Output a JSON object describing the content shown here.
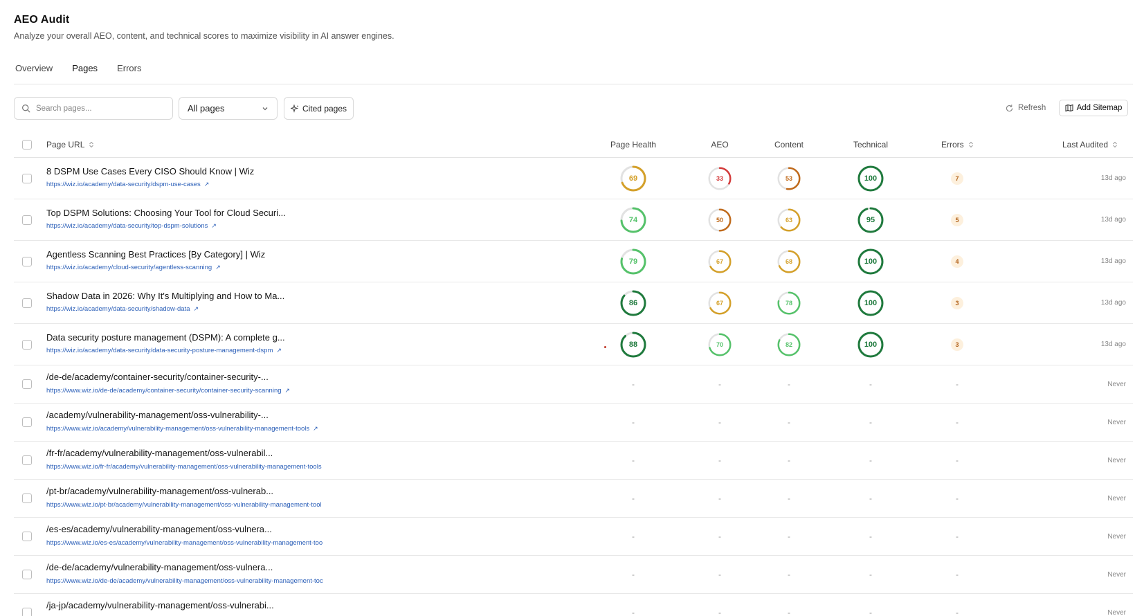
{
  "header": {
    "title": "AEO Audit",
    "subtitle": "Analyze your overall AEO, content, and technical scores to maximize visibility in AI answer engines."
  },
  "tabs": [
    "Overview",
    "Pages",
    "Errors"
  ],
  "active_tab": "Pages",
  "toolbar": {
    "search_placeholder": "Search pages...",
    "filter_value": "All pages",
    "cited_label": "Cited pages",
    "refresh_label": "Refresh",
    "sitemap_label": "Add Sitemap"
  },
  "columns": {
    "url": "Page URL",
    "health": "Page Health",
    "aeo": "AEO",
    "content": "Content",
    "technical": "Technical",
    "errors": "Errors",
    "audited": "Last Audited"
  },
  "colors": {
    "good": "#1f7a3d",
    "ok": "#55c26a",
    "warn": "#d4a029",
    "poor": "#c06a1b",
    "bad": "#d43a3a",
    "link": "#2b5fb8"
  },
  "rows": [
    {
      "title": "8 DSPM Use Cases Every CISO Should Know | Wiz",
      "url": "https://wiz.io/academy/data-security/dspm-use-cases",
      "health": "69",
      "aeo": "33",
      "content": "53",
      "technical": "100",
      "errors": "7",
      "audited": "13d ago"
    },
    {
      "title": "Top DSPM Solutions: Choosing Your Tool for Cloud Securi...",
      "url": "https://wiz.io/academy/data-security/top-dspm-solutions",
      "health": "74",
      "aeo": "50",
      "content": "63",
      "technical": "95",
      "errors": "5",
      "audited": "13d ago"
    },
    {
      "title": "Agentless Scanning Best Practices [By Category] | Wiz",
      "url": "https://wiz.io/academy/cloud-security/agentless-scanning",
      "health": "79",
      "aeo": "67",
      "content": "68",
      "technical": "100",
      "errors": "4",
      "audited": "13d ago"
    },
    {
      "title": "Shadow Data in 2026: Why It's Multiplying and How to Ma...",
      "url": "https://wiz.io/academy/data-security/shadow-data",
      "health": "86",
      "aeo": "67",
      "content": "78",
      "technical": "100",
      "errors": "3",
      "audited": "13d ago"
    },
    {
      "title": "Data security posture management (DSPM): A complete g...",
      "url": "https://wiz.io/academy/data-security/data-security-posture-management-dspm",
      "health": "88",
      "aeo": "70",
      "content": "82",
      "technical": "100",
      "errors": "3",
      "audited": "13d ago"
    },
    {
      "title": "/de-de/academy/container-security/container-security-...",
      "url": "https://www.wiz.io/de-de/academy/container-security/container-security-scanning",
      "health": "-",
      "aeo": "-",
      "content": "-",
      "technical": "-",
      "errors": "-",
      "audited": "Never"
    },
    {
      "title": "/academy/vulnerability-management/oss-vulnerability-...",
      "url": "https://www.wiz.io/academy/vulnerability-management/oss-vulnerability-management-tools",
      "health": "-",
      "aeo": "-",
      "content": "-",
      "technical": "-",
      "errors": "-",
      "audited": "Never"
    },
    {
      "title": "/fr-fr/academy/vulnerability-management/oss-vulnerabil...",
      "url": "https://www.wiz.io/fr-fr/academy/vulnerability-management/oss-vulnerability-management-tools",
      "health": "-",
      "aeo": "-",
      "content": "-",
      "technical": "-",
      "errors": "-",
      "audited": "Never"
    },
    {
      "title": "/pt-br/academy/vulnerability-management/oss-vulnerab...",
      "url": "https://www.wiz.io/pt-br/academy/vulnerability-management/oss-vulnerability-management-tool",
      "health": "-",
      "aeo": "-",
      "content": "-",
      "technical": "-",
      "errors": "-",
      "audited": "Never"
    },
    {
      "title": "/es-es/academy/vulnerability-management/oss-vulnera...",
      "url": "https://www.wiz.io/es-es/academy/vulnerability-management/oss-vulnerability-management-too",
      "health": "-",
      "aeo": "-",
      "content": "-",
      "technical": "-",
      "errors": "-",
      "audited": "Never"
    },
    {
      "title": "/de-de/academy/vulnerability-management/oss-vulnera...",
      "url": "https://www.wiz.io/de-de/academy/vulnerability-management/oss-vulnerability-management-toc",
      "health": "-",
      "aeo": "-",
      "content": "-",
      "technical": "-",
      "errors": "-",
      "audited": "Never"
    },
    {
      "title": "/ja-jp/academy/vulnerability-management/oss-vulnerabi...",
      "url": "",
      "health": "-",
      "aeo": "-",
      "content": "-",
      "technical": "-",
      "errors": "-",
      "audited": "Never"
    }
  ]
}
